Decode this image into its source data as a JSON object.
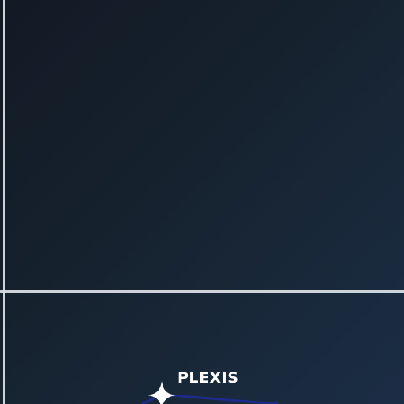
{
  "map": {
    "node": {
      "label": "PLEXIS",
      "icon": "four-point-star-icon",
      "color": "#ffffff"
    },
    "route_color": "#1d2a8c",
    "guide_color": "#d9dde3"
  }
}
